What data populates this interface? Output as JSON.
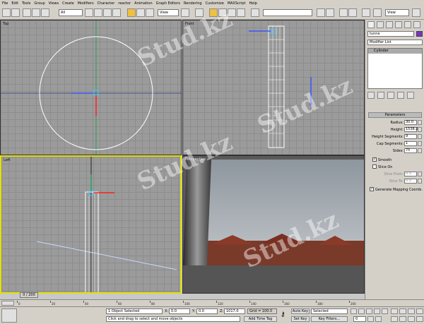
{
  "menu": [
    "File",
    "Edit",
    "Tools",
    "Group",
    "Views",
    "Create",
    "Modifiers",
    "Character",
    "reactor",
    "Animation",
    "Graph Editors",
    "Rendering",
    "Customize",
    "MAXScript",
    "Help"
  ],
  "toolbar": {
    "selection_filter": "All",
    "ref_coord": "View",
    "named_selection": "",
    "render_preset": "View"
  },
  "viewports": {
    "top": "Top",
    "front": "Front",
    "left": "Left",
    "perspective": "Perspective"
  },
  "command_panel": {
    "object_name": "tunne",
    "modifier_list": "Modifier List",
    "stack_item": "Cylinder",
    "rollout_title": "Parameters",
    "params": [
      {
        "label": "Radius:",
        "value": "30.0"
      },
      {
        "label": "Height:",
        "value": "1538.2"
      },
      {
        "label": "Height Segments:",
        "value": "9"
      },
      {
        "label": "Cap Segments:",
        "value": "1"
      },
      {
        "label": "Sides:",
        "value": "75"
      }
    ],
    "smooth_label": "Smooth",
    "slice_on_label": "Slice On",
    "slice_from_label": "Slice From:",
    "slice_from_value": "0.0",
    "slice_to_label": "Slice To:",
    "slice_to_value": "0.0",
    "mapping_label": "Generate Mapping Coords."
  },
  "timeline": {
    "frame_counter": "0 / 200",
    "ticks": [
      "0",
      "20",
      "40",
      "60",
      "80",
      "100",
      "120",
      "140",
      "160",
      "180",
      "200"
    ]
  },
  "status": {
    "selected": "1 Object Selected",
    "prompt": "Click and drag to select and move objects",
    "x_label": "X:",
    "x_value": "0.0",
    "y_label": "Y:",
    "y_value": "0.0",
    "z_label": "Z:",
    "z_value": "1017.0",
    "grid": "Grid = 100.0",
    "add_time_tag": "Add Time Tag",
    "auto_key": "Auto Key",
    "selected_dropdown": "Selected",
    "set_key": "Set Key",
    "key_filters": "Key Filters...",
    "frame": "0"
  },
  "watermark": "Stud.kz"
}
